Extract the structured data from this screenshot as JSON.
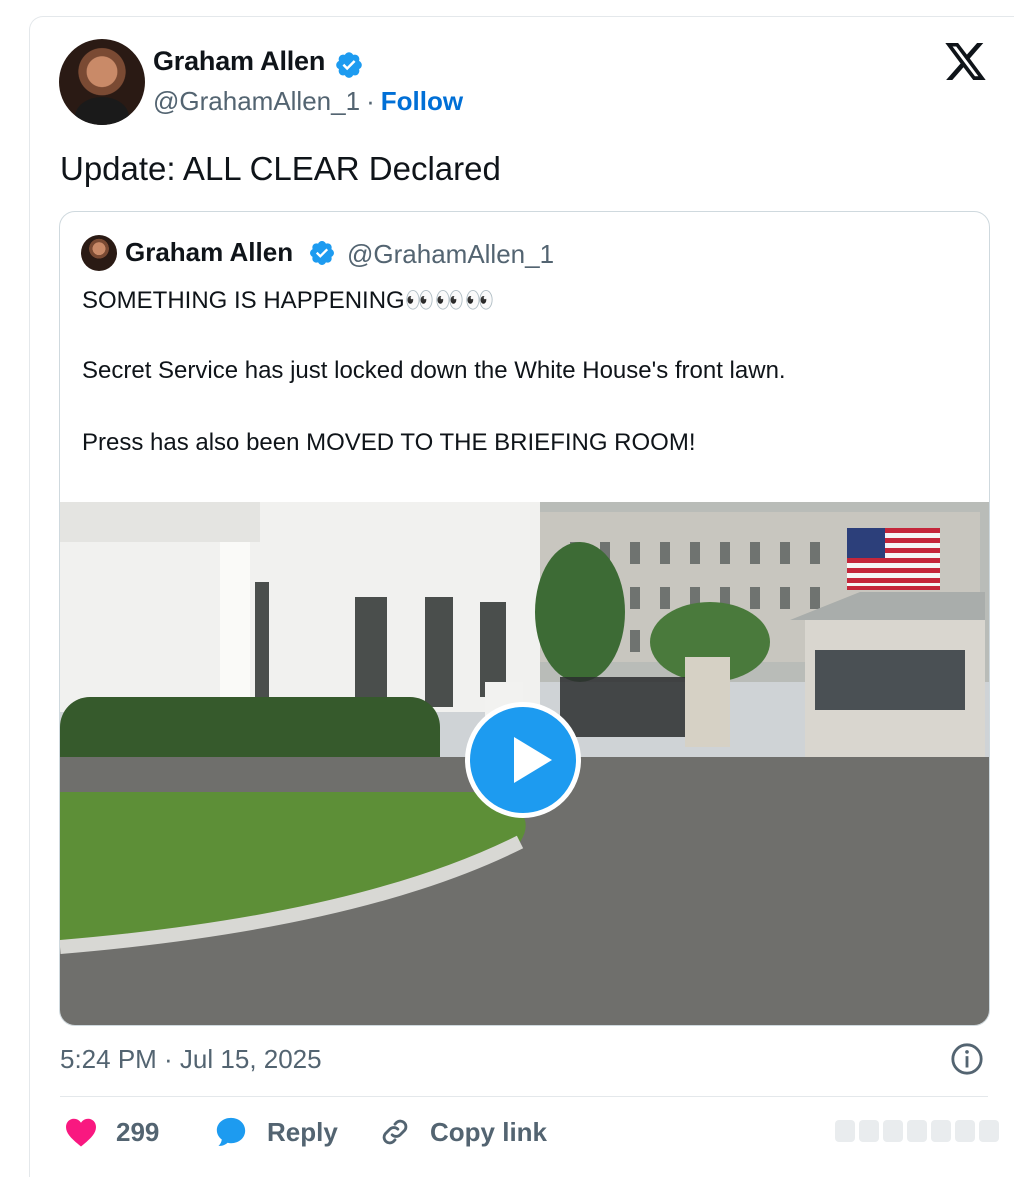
{
  "tweet": {
    "author_name": "Graham Allen",
    "handle": "@GrahamAllen_1",
    "separator": "·",
    "follow_label": "Follow",
    "text": "Update: ALL CLEAR Declared",
    "timestamp": "5:24 PM · Jul 15, 2025"
  },
  "quoted": {
    "author_name": "Graham Allen",
    "handle": "@GrahamAllen_1",
    "line1": "SOMETHING IS HAPPENING👀👀👀",
    "line2": "Secret Service has just locked down the White House's front lawn.",
    "line3": "Press has also been MOVED TO THE BRIEFING ROOM!"
  },
  "actions": {
    "likes": "299",
    "reply_label": "Reply",
    "copy_label": "Copy link"
  },
  "colors": {
    "accent": "#1d9bf0",
    "follow": "#006fd6",
    "like": "#f91880",
    "muted": "#536471"
  },
  "icons": [
    "verified-badge-icon",
    "x-logo-icon",
    "play-icon",
    "info-icon",
    "heart-icon",
    "reply-icon",
    "link-icon"
  ]
}
